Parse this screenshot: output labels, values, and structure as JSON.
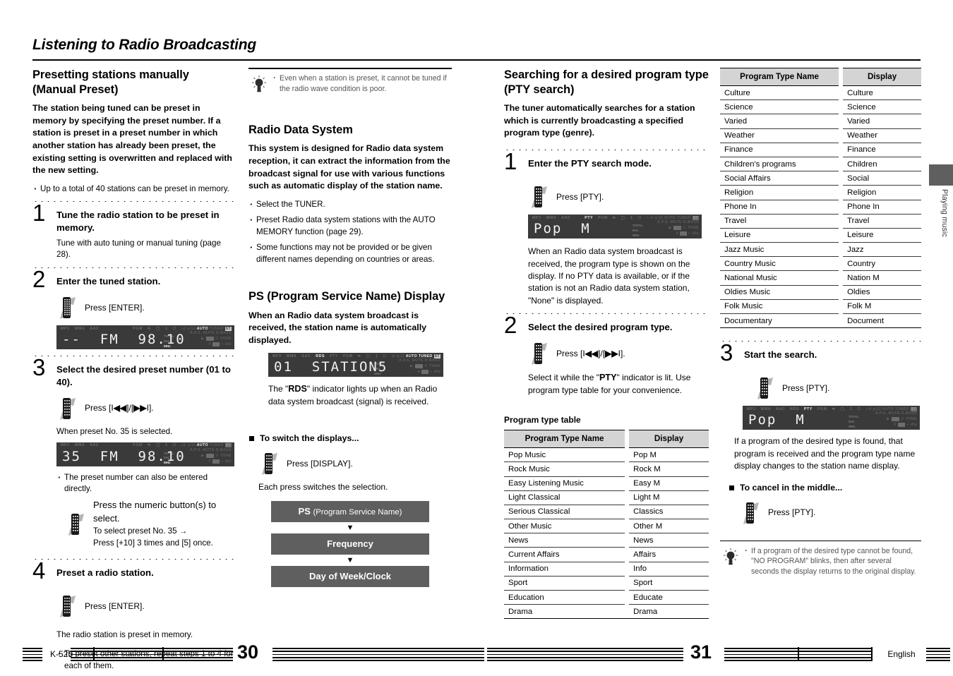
{
  "document": {
    "title": "Listening to Radio Broadcasting",
    "side_tab_label": "Playing music"
  },
  "footer": {
    "model": "K-525",
    "left_page": "30",
    "right_page": "31",
    "language": "English"
  },
  "col1": {
    "heading": "Presetting stations manually (Manual Preset)",
    "lead": "The station being tuned can be preset in memory by specifying the preset number. If a station is preset in a preset number in which another station has already been preset, the existing setting is overwritten and replaced with the new setting.",
    "bullets": [
      "Up to a total of 40  stations can be preset in memory."
    ],
    "steps": [
      {
        "num": "1",
        "title": "Tune the radio station to be preset in memory.",
        "sub": "Tune with auto tuning or manual tuning (page 28)."
      },
      {
        "num": "2",
        "title": "Enter the tuned station.",
        "press": "Press [ENTER]."
      },
      {
        "num": "3",
        "title": "Select the desired preset number (01 to 40).",
        "press_pre": "Press [I",
        "press_mid": "]/[",
        "press_post": "I].",
        "caption": "When preset No. 35 is selected.",
        "note_bullet": "The preset number can also be entered directly.",
        "note_press": "Press the numeric button(s) to select.",
        "note_line1": "To select preset No. 35 →",
        "note_line2": "Press [+10] 3 times and [5] once."
      },
      {
        "num": "4",
        "title": "Preset a radio station.",
        "press": "Press [ENTER].",
        "sub": "The radio station is preset in memory.",
        "bullet": "To preset other stations, repeat steps 1 to 4 for each of them."
      }
    ],
    "lcd_step2": {
      "text": "--  FM  98.10",
      "indicators_top": [
        "MP3",
        "WMA",
        "AAC",
        "PGM",
        "⤨",
        "◯",
        "1",
        "☐",
        "♪"
      ],
      "right_line1": "AUTO TUNED ST",
      "right_line2": "A.P.S. MUTE D-BASS",
      "right_line3": "TOTAL  ▶  TONE",
      "right_line4": "MHz  ‖  dts",
      "unit": "MHz"
    },
    "lcd_step3": {
      "text": "35  FM  98.10",
      "right_line1": "AUTO TUNED ST",
      "unit": "MHz"
    }
  },
  "col2": {
    "tip": "Even when a station is preset, it cannot be tuned if the radio wave condition is poor.",
    "rds_heading": "Radio Data System",
    "rds_lead": "This system is designed for Radio data system reception, it can extract the information from the broadcast signal for use with various functions such as automatic display of the station name.",
    "rds_bullets": [
      "Select the TUNER.",
      "Preset Radio data system stations with the AUTO MEMORY function (page 29).",
      "Some functions may not be provided or be given different names depending on countries or areas."
    ],
    "ps_heading": "PS (Program Service Name) Display",
    "ps_lead": "When an Radio data system broadcast is received, the station name is automatically displayed.",
    "ps_lcd": {
      "text": "01  STATION5",
      "rds_on": "RDS"
    },
    "ps_note_pre": "The \"",
    "ps_note_mark": "RDS",
    "ps_note_post": "\" indicator lights up when an Radio data system broadcast (signal) is received.",
    "switch_heading": "To switch the displays...",
    "switch_press": "Press [DISPLAY].",
    "switch_sub": "Each press switches the selection.",
    "flow": [
      {
        "bold": "PS",
        "rest": "(Program Service Name)"
      },
      {
        "bold": "Frequency",
        "rest": ""
      },
      {
        "bold": "Day of Week/Clock",
        "rest": ""
      }
    ],
    "flow_arrow": "▼"
  },
  "col3": {
    "heading": "Searching for a desired program type (PTY search)",
    "lead": "The tuner automatically searches for a station which is currently broadcasting a specified program type (genre).",
    "steps": [
      {
        "num": "1",
        "title": "Enter the PTY search mode.",
        "press": "Press [PTY].",
        "sub": "When an Radio data system broadcast is received, the program type is shown on the display. If no PTY data is available, or if the station is not an Radio data system station, \"None\" is displayed."
      },
      {
        "num": "2",
        "title": "Select the desired program type.",
        "press_pre": "Press [I",
        "press_mid": "]/[",
        "press_post": "I].",
        "sub_pre": "Select it while the \"",
        "sub_mark": "PTY",
        "sub_post": "\" indicator is lit. Use program type table for your convenience."
      }
    ],
    "lcd_pty": {
      "text": "Pop  M",
      "pty_on": "PTY"
    },
    "table_caption": "Program type table",
    "table": {
      "headers": [
        "Program Type Name",
        "Display"
      ],
      "rows": [
        [
          "Pop Music",
          "Pop M"
        ],
        [
          "Rock Music",
          "Rock M"
        ],
        [
          "Easy Listening Music",
          "Easy M"
        ],
        [
          "Light Classical",
          "Light M"
        ],
        [
          "Serious Classical",
          "Classics"
        ],
        [
          "Other Music",
          "Other M"
        ],
        [
          "News",
          "News"
        ],
        [
          "Current Affairs",
          "Affairs"
        ],
        [
          "Information",
          "Info"
        ],
        [
          "Sport",
          "Sport"
        ],
        [
          "Education",
          "Educate"
        ],
        [
          "Drama",
          "Drama"
        ]
      ]
    }
  },
  "col4": {
    "table": {
      "headers": [
        "Program Type Name",
        "Display"
      ],
      "rows": [
        [
          "Culture",
          "Culture"
        ],
        [
          "Science",
          "Science"
        ],
        [
          "Varied",
          "Varied"
        ],
        [
          "Weather",
          "Weather"
        ],
        [
          "Finance",
          "Finance"
        ],
        [
          "Children's programs",
          "Children"
        ],
        [
          "Social Affairs",
          "Social"
        ],
        [
          "Religion",
          "Religion"
        ],
        [
          "Phone In",
          "Phone In"
        ],
        [
          "Travel",
          "Travel"
        ],
        [
          "Leisure",
          "Leisure"
        ],
        [
          "Jazz Music",
          "Jazz"
        ],
        [
          "Country Music",
          "Country"
        ],
        [
          "National Music",
          "Nation M"
        ],
        [
          "Oldies Music",
          "Oldies"
        ],
        [
          "Folk Music",
          "Folk M"
        ],
        [
          "Documentary",
          "Document"
        ]
      ]
    },
    "step3": {
      "num": "3",
      "title": "Start the search.",
      "press": "Press [PTY].",
      "sub": "If a program of the desired type is found, that program is received and the program type name display changes to the station name display."
    },
    "lcd_pty": {
      "text": "Pop  M",
      "pty_on": "PTY",
      "rds_on": "RDS"
    },
    "cancel_heading": "To cancel in the middle...",
    "cancel_press": "Press [PTY].",
    "tip": "If a program of the desired type cannot be found, \"NO PROGRAM\" blinks, then after several seconds the display returns to the original display."
  }
}
